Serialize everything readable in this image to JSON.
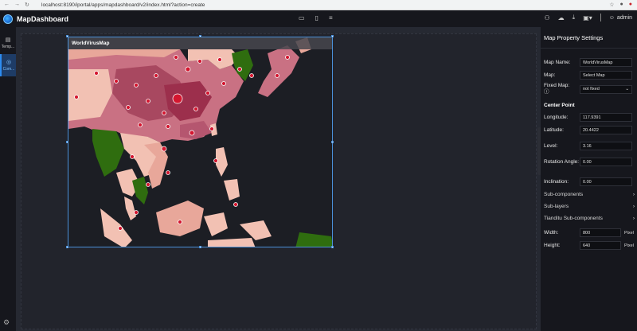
{
  "browser": {
    "url": "localhost:8190/iportal/apps/mapdashboard/v2/index.html?action=create"
  },
  "app": {
    "title": "MapDashboard",
    "user": "admin"
  },
  "sidebar": {
    "items": [
      {
        "label": "Temp...",
        "icon": "template-icon"
      },
      {
        "label": "Com...",
        "icon": "component-icon"
      }
    ]
  },
  "map": {
    "title": "WorldVirusMap",
    "colors": {
      "border": "#4a90d9",
      "low": "#f2c1b3",
      "mid": "#c97183",
      "high": "#9c2f4c",
      "green": "#2f6d0f",
      "point": "#d4162f"
    }
  },
  "panel": {
    "title": "Map Property Settings",
    "map_name_label": "Map Name:",
    "map_name_value": "WorldVirusMap",
    "map_label": "Map:",
    "map_value": "Select Map",
    "fixed_map_label": "Fixed Map:",
    "fixed_map_value": "not fixed",
    "center_point_title": "Center Point",
    "longitude_label": "Longitude:",
    "longitude_value": "117.9391",
    "latitude_label": "Latitude:",
    "latitude_value": "20.4422",
    "level_label": "Level:",
    "level_value": "3.16",
    "rotation_label": "Rotation Angle:",
    "rotation_value": "0.00",
    "inclination_label": "Inclination:",
    "inclination_value": "0.00",
    "sub_components": "Sub-components",
    "sub_layers": "Sub-layers",
    "tianditu": "Tianditu Sub-components",
    "width_label": "Width:",
    "width_value": "800",
    "height_label": "Height:",
    "height_value": "640",
    "unit": "Pixel"
  }
}
